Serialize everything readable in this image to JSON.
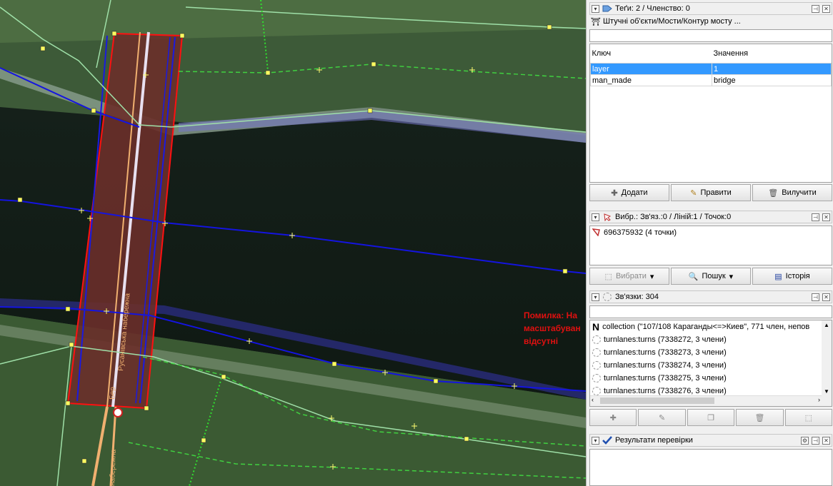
{
  "map": {
    "error_lines": [
      "Помилка: На",
      "масштабуван",
      "відсутні"
    ],
    "street_label_main": "Русанівська набережна",
    "street_label_bottom": "набережна",
    "street_label_mid": "Бер"
  },
  "tags_panel": {
    "title": "Теґи: 2 / Членство: 0",
    "preset_path": "Штучні об'єкти/Мости/Контур мосту ...",
    "col_key": "Ключ",
    "col_value": "Значення",
    "rows": [
      {
        "key": "layer",
        "value": "1",
        "selected": true
      },
      {
        "key": "man_made",
        "value": "bridge",
        "selected": false
      }
    ],
    "add_label": "Додати",
    "edit_label": "Правити",
    "delete_label": "Вилучити"
  },
  "selection_panel": {
    "title": "Вибр.: Зв'яз.:0 / Ліній:1 / Точок:0",
    "item": "696375932 (4 точки)",
    "select_label": "Вибрати",
    "search_label": "Пошук",
    "history_label": "Історія"
  },
  "relations_panel": {
    "title": "Зв'язки: 304",
    "items": [
      "collection (\"107/108 Караганды<=>Киев\", 771 член, непов",
      "turnlanes:turns (7338272, 3 члени)",
      "turnlanes:turns (7338273, 3 члени)",
      "turnlanes:turns (7338274, 3 члени)",
      "turnlanes:turns (7338275, 3 члени)",
      "turnlanes:turns (7338276, 3 члени)"
    ]
  },
  "validation_panel": {
    "title": "Результати перевірки"
  },
  "colors": {
    "selected_way": "#ff1010",
    "waterway": "#1414e0",
    "footway": "#90e0a0",
    "selection_blue": "#3399ff"
  }
}
